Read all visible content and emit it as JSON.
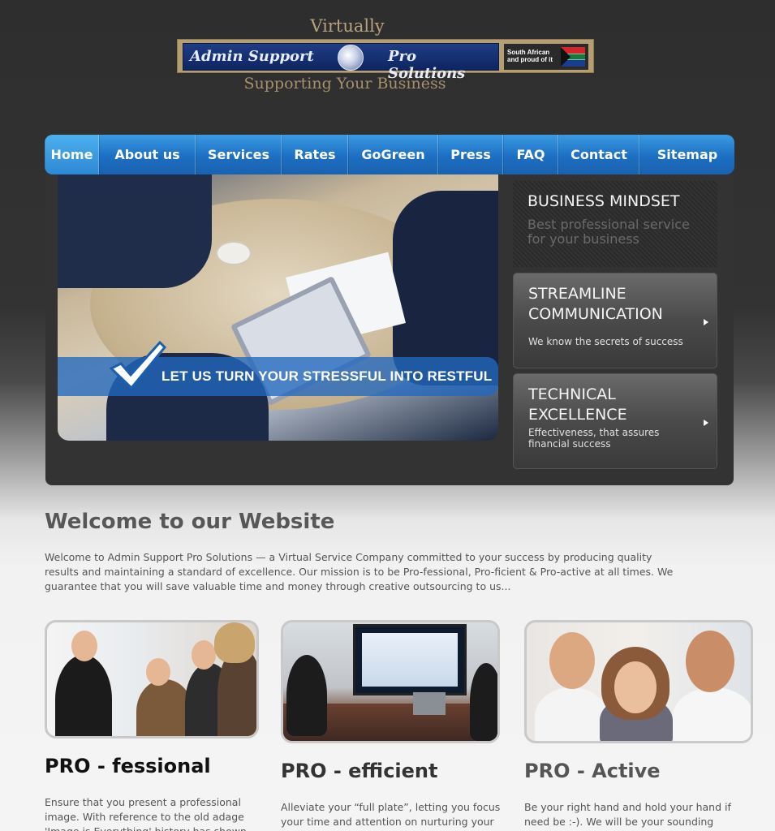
{
  "header": {
    "logo_top": "Virtually",
    "logo_left": "Admin Support",
    "logo_right": "Pro Solutions",
    "logo_badge": "South African\nand proud of it",
    "logo_tagline": "Supporting Your Business",
    "logo_icon": "globe-icon"
  },
  "nav": {
    "items": [
      {
        "label": "Home",
        "active": true
      },
      {
        "label": "About us"
      },
      {
        "label": "Services"
      },
      {
        "label": "Rates"
      },
      {
        "label": "GoGreen"
      },
      {
        "label": "Press"
      },
      {
        "label": "FAQ"
      },
      {
        "label": "Contact"
      },
      {
        "label": "Sitemap"
      }
    ],
    "accent": "#1c6ec2"
  },
  "hero": {
    "banner_text": "LET US TURN YOUR STRESSFUL INTO RESTFUL",
    "banner_icon": "checkmark-icon",
    "boxes": [
      {
        "title": "BUSINESS MINDSET",
        "subtitle": "Best professional service\nfor your business"
      },
      {
        "title": "STREAMLINE\nCOMMUNICATION",
        "subtitle": "We know the secrets of success"
      },
      {
        "title": "TECHNICAL\nEXCELLENCE",
        "subtitle": "Effectiveness, that assures\nfinancial success"
      }
    ]
  },
  "welcome": {
    "title": "Welcome to our Website",
    "text": "Welcome to Admin Support Pro Solutions — a Virtual Service Company committed to your success by producing quality results and maintaining a standard of excellence. Our mission is to be Pro-fessional, Pro-ficient & Pro-active at all times. We guarantee that you will save valuable time and money through creative outsourcing to us..."
  },
  "columns": [
    {
      "title": "PRO - fessional",
      "text": "Ensure that you present a professional image. With reference to the old adage 'Image is Everything' history has shown"
    },
    {
      "title": "PRO - efficient",
      "text": "Alleviate your “full plate”, letting you focus your time and attention on nurturing your"
    },
    {
      "title": "PRO - Active",
      "text": "Be your right hand and hold your hand if need be :-). We will be your sounding"
    }
  ]
}
